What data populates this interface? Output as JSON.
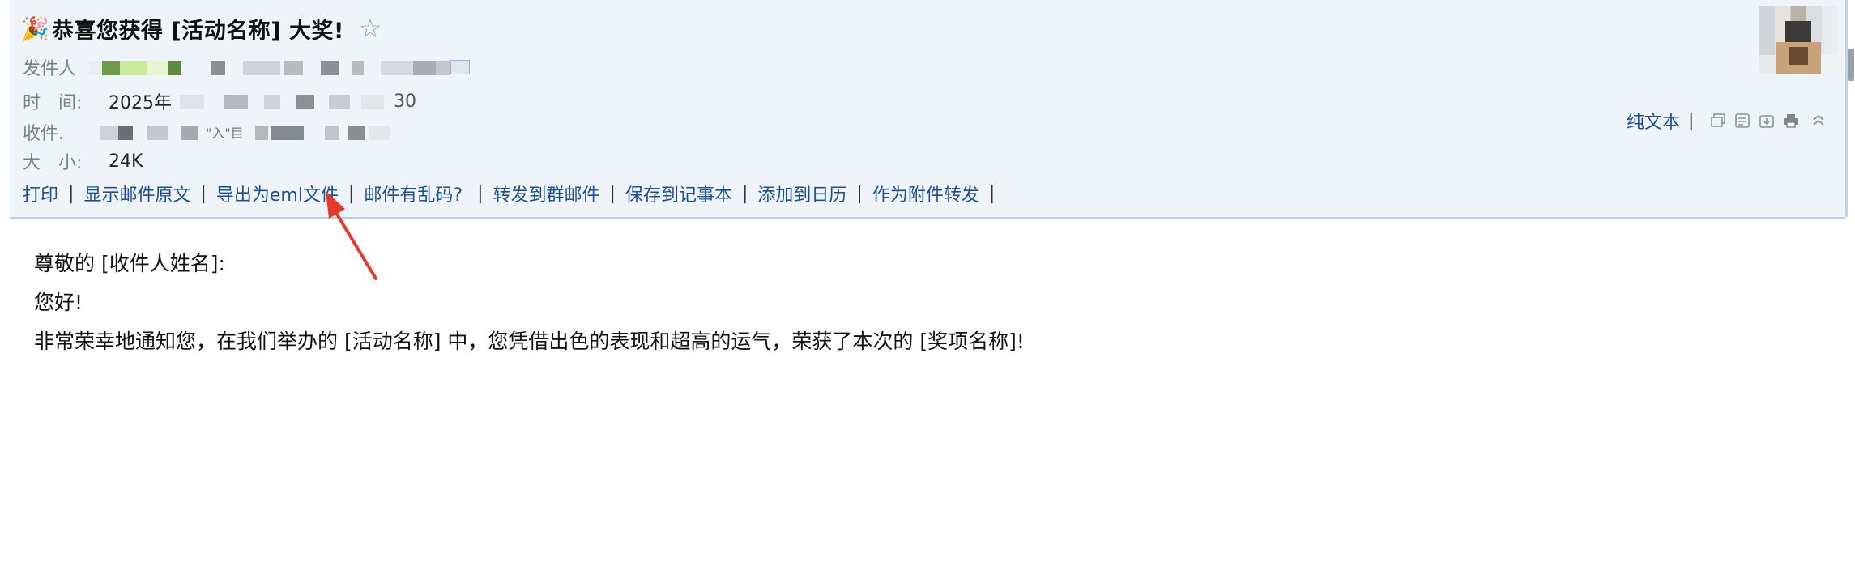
{
  "mail": {
    "party_icon": "🎉",
    "subject": "恭喜您获得 [活动名称] 大奖!",
    "star_icon": "☆",
    "meta": {
      "sender_label": "发件人",
      "time_label": "时　间:",
      "time_value_visible": "2025年",
      "time_value_tail": "30",
      "recipient_label": "收件.",
      "recipient_partial": "\"入\"目",
      "size_label": "大　小:",
      "size_value": "24K"
    },
    "actions": [
      "打印",
      "显示邮件原文",
      "导出为eml文件",
      "邮件有乱码?",
      "转发到群邮件",
      "保存到记事本",
      "添加到日历",
      "作为附件转发"
    ],
    "plain_text": "纯文本",
    "tool_icons": [
      "copy-window-icon",
      "note-icon",
      "download-icon",
      "print-icon",
      "collapse-icon"
    ],
    "body": {
      "greeting": "尊敬的 [收件人姓名]:",
      "hello": "您好!",
      "paragraph": "非常荣幸地通知您，在我们举办的 [活动名称] 中，您凭借出色的表现和超高的运气，荣获了本次的 [奖项名称]!"
    },
    "colors": {
      "header_bg": "#eff4fa",
      "link": "#1f4f8f",
      "annotation_arrow": "#e53b2c"
    }
  }
}
